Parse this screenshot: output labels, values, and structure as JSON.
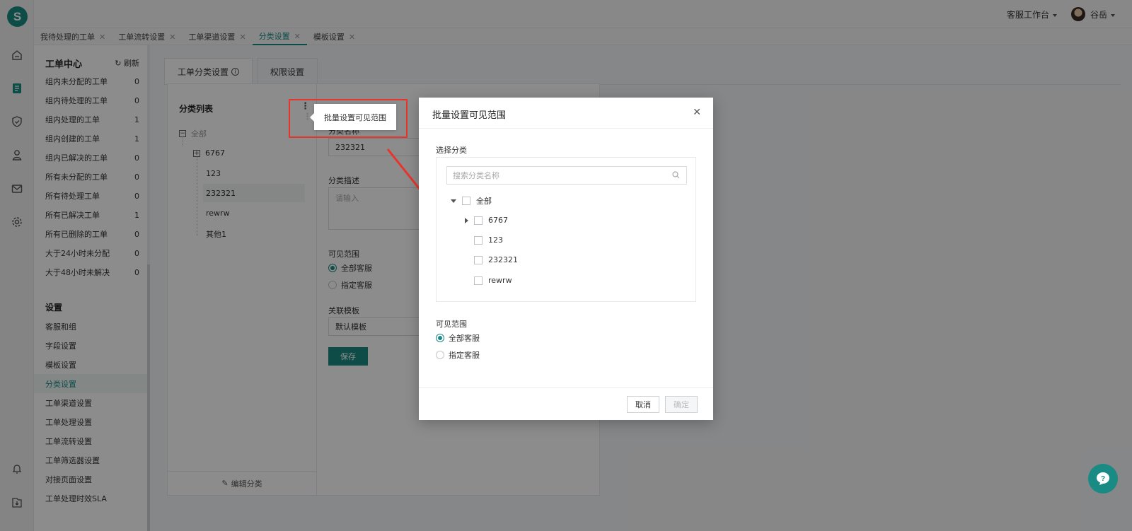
{
  "app": {
    "logo_letter": "S",
    "accent": "#1a8a84",
    "workspace_label": "客服工作台",
    "user_name": "谷岳"
  },
  "rail_icons": [
    "home-icon",
    "ticket-icon",
    "shield-icon",
    "user-icon",
    "mail-icon",
    "gear-icon",
    "bell-icon",
    "download-icon"
  ],
  "tabs": [
    {
      "label": "我待处理的工单",
      "active": false
    },
    {
      "label": "工单流转设置",
      "active": false
    },
    {
      "label": "工单渠道设置",
      "active": false
    },
    {
      "label": "分类设置",
      "active": true
    },
    {
      "label": "模板设置",
      "active": false
    }
  ],
  "menu": {
    "title": "工单中心",
    "refresh_label": "刷新",
    "items": [
      {
        "label": "组内未分配的工单",
        "count": "0"
      },
      {
        "label": "组内待处理的工单",
        "count": "0"
      },
      {
        "label": "组内处理的工单",
        "count": "1"
      },
      {
        "label": "组内创建的工单",
        "count": "1"
      },
      {
        "label": "组内已解决的工单",
        "count": "0"
      },
      {
        "label": "所有未分配的工单",
        "count": "0"
      },
      {
        "label": "所有待处理工单",
        "count": "0"
      },
      {
        "label": "所有已解决工单",
        "count": "1"
      },
      {
        "label": "所有已删除的工单",
        "count": "0"
      },
      {
        "label": "大于24小时未分配",
        "count": "0"
      },
      {
        "label": "大于48小时未解决",
        "count": "0"
      }
    ],
    "settings_title": "设置",
    "settings": [
      {
        "label": "客服和组",
        "active": false
      },
      {
        "label": "字段设置",
        "active": false
      },
      {
        "label": "模板设置",
        "active": false
      },
      {
        "label": "分类设置",
        "active": true
      },
      {
        "label": "工单渠道设置",
        "active": false
      },
      {
        "label": "工单处理设置",
        "active": false
      },
      {
        "label": "工单流转设置",
        "active": false
      },
      {
        "label": "工单筛选器设置",
        "active": false
      },
      {
        "label": "对接页面设置",
        "active": false
      },
      {
        "label": "工单处理时效SLA",
        "active": false
      }
    ]
  },
  "content": {
    "tabs": [
      "工单分类设置",
      "权限设置"
    ],
    "category_panel": {
      "title": "分类列表",
      "root": "全部",
      "nodes": [
        "6767",
        "123",
        "232321",
        "rewrw",
        "其他1"
      ],
      "edit_label": "编辑分类"
    },
    "form": {
      "name_label": "分类名称",
      "name_value": "232321",
      "desc_label": "分类描述",
      "desc_placeholder": "请输入",
      "scope_label": "可见范围",
      "scope_options": [
        "全部客服",
        "指定客服"
      ],
      "template_label": "关联模板",
      "template_value": "默认模板",
      "save_label": "保存"
    }
  },
  "tooltip": {
    "text": "批量设置可见范围",
    "highlight_color": "#e8352b"
  },
  "modal": {
    "title": "批量设置可见范围",
    "select_label": "选择分类",
    "search_placeholder": "搜索分类名称",
    "tree_root": "全部",
    "tree_nodes": [
      "6767",
      "123",
      "232321",
      "rewrw"
    ],
    "scope_label": "可见范围",
    "scope_options": [
      "全部客服",
      "指定客服"
    ],
    "cancel_label": "取消",
    "confirm_label": "确定"
  }
}
